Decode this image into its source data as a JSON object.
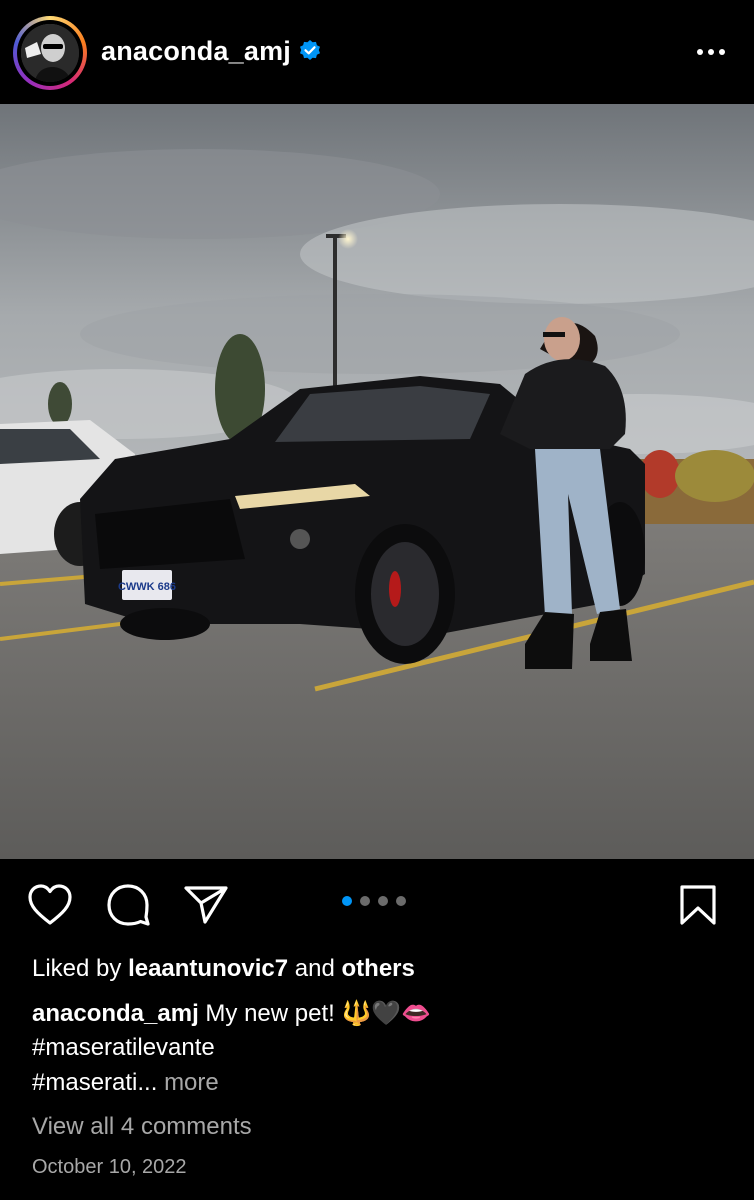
{
  "header": {
    "username": "anaconda_amj",
    "verified": true,
    "avatar_icon": "profile-avatar",
    "more_icon": "more-horizontal-icon"
  },
  "post": {
    "carousel": {
      "count": 4,
      "active_index": 0
    },
    "actions": [
      "heart-icon",
      "comment-icon",
      "share-icon",
      "bookmark-icon"
    ],
    "likes": {
      "prefix": "Liked by",
      "user": "leaantunovic7",
      "joiner": "and",
      "others": "others"
    },
    "caption": {
      "username": "anaconda_amj",
      "text": "My new pet! 🔱🖤👄",
      "hashtag1": "#maseratilevante",
      "hashtag2": "#maserati...",
      "more": "more"
    },
    "comments_link": "View all 4 comments",
    "date": "October 10, 2022"
  },
  "colors": {
    "background": "#000000",
    "accent": "#0095f6",
    "muted": "#a8a8a8",
    "verified": "#0095f6"
  },
  "photo_text": {
    "plate": "CWWK 686"
  }
}
